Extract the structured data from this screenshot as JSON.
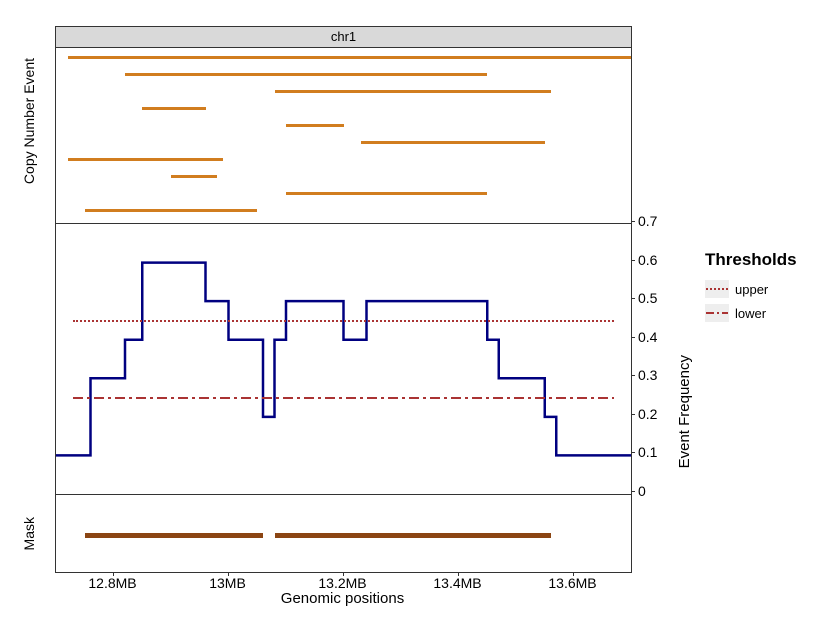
{
  "strip": "chr1",
  "xlabel": "Genomic positions",
  "y_right_label": "Event Frequency",
  "panel_labels": {
    "cne": "Copy Number Event",
    "freq": "",
    "mask": "Mask"
  },
  "legend": {
    "title": "Thresholds",
    "upper": "upper",
    "lower": "lower"
  },
  "x_ticks": [
    "12.8MB",
    "13MB",
    "13.2MB",
    "13.4MB",
    "13.6MB"
  ],
  "y_ticks_freq": [
    "0",
    "0.1",
    "0.2",
    "0.3",
    "0.4",
    "0.5",
    "0.6",
    "0.7"
  ],
  "chart_data": {
    "type": "line",
    "x_range_mb": [
      12.7,
      13.7
    ],
    "thresholds": {
      "upper": 0.45,
      "lower": 0.25
    },
    "cne_events": [
      {
        "start": 12.72,
        "end": 13.7,
        "row": 0
      },
      {
        "start": 12.82,
        "end": 13.45,
        "row": 1
      },
      {
        "start": 13.08,
        "end": 13.56,
        "row": 2
      },
      {
        "start": 12.85,
        "end": 12.96,
        "row": 3
      },
      {
        "start": 13.1,
        "end": 13.2,
        "row": 4
      },
      {
        "start": 13.23,
        "end": 13.55,
        "row": 5
      },
      {
        "start": 12.72,
        "end": 12.99,
        "row": 6
      },
      {
        "start": 12.9,
        "end": 12.98,
        "row": 7
      },
      {
        "start": 13.1,
        "end": 13.45,
        "row": 8
      },
      {
        "start": 12.75,
        "end": 13.05,
        "row": 9
      }
    ],
    "frequency_step": {
      "x": [
        12.7,
        12.75,
        12.76,
        12.82,
        12.85,
        12.96,
        13.0,
        13.06,
        13.08,
        13.1,
        13.2,
        13.24,
        13.45,
        13.47,
        13.55,
        13.57,
        13.7
      ],
      "y": [
        0.1,
        0.1,
        0.3,
        0.4,
        0.6,
        0.5,
        0.4,
        0.2,
        0.4,
        0.5,
        0.4,
        0.5,
        0.4,
        0.3,
        0.2,
        0.1,
        0.1
      ]
    },
    "mask_segments": [
      {
        "start": 12.75,
        "end": 13.06
      },
      {
        "start": 13.08,
        "end": 13.56
      }
    ]
  }
}
